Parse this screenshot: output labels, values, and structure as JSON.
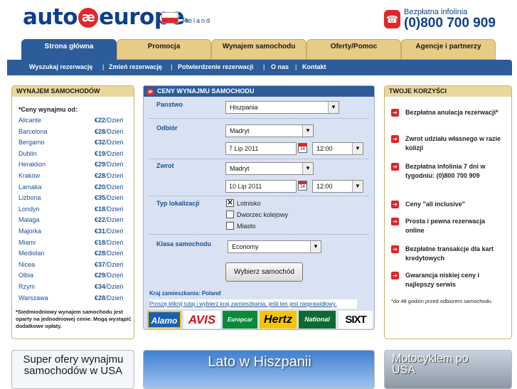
{
  "header": {
    "logo": {
      "left": "auto",
      "mark": "æ",
      "right": "europe",
      "reg": "®"
    },
    "country": "Poland",
    "hotline_label": "Bezpłatna infolinia",
    "hotline_number": "(0)800 700 909"
  },
  "tabs": [
    "Strona główna",
    "Promocja",
    "Wynajem samochodu",
    "Oferty/Pomoc",
    "Agencje i partnerzy"
  ],
  "subnav": [
    "Wyszukaj rezerwację",
    "Zmień rezerwację",
    "Potwierdzenie rezerwacji",
    "O nas",
    "Kontakt"
  ],
  "left": {
    "title": "WYNAJEM SAMOCHODÓW",
    "intro": "*Ceny wynajmu od:",
    "unit": "/Dzień",
    "items": [
      {
        "city": "Alicante",
        "price": "€22"
      },
      {
        "city": "Barcelona",
        "price": "€28"
      },
      {
        "city": "Bergamo",
        "price": "€32"
      },
      {
        "city": "Dublin",
        "price": "€19"
      },
      {
        "city": "Heraklion",
        "price": "€29"
      },
      {
        "city": "Kraków",
        "price": "€28"
      },
      {
        "city": "Larnaka",
        "price": "€20"
      },
      {
        "city": "Lizbona",
        "price": "€35"
      },
      {
        "city": "Londyn",
        "price": "€18"
      },
      {
        "city": "Malaga",
        "price": "€22"
      },
      {
        "city": "Majorka",
        "price": "€31"
      },
      {
        "city": "Miami",
        "price": "€18"
      },
      {
        "city": "Mediolan",
        "price": "€28"
      },
      {
        "city": "Nicea",
        "price": "€37"
      },
      {
        "city": "Olbia",
        "price": "€29"
      },
      {
        "city": "Rzym",
        "price": "€34"
      },
      {
        "city": "Warszawa",
        "price": "€28"
      }
    ],
    "footnote": "*Siedmiodniowy wynajem samochodu jest oparty na jednodniowej cenie. Mogą wystąpić dodatkowe opłaty."
  },
  "form": {
    "title": "CENY WYNAJMU SAMOCHODU",
    "country_label": "Panstwo",
    "country_value": "Hiszpania",
    "pickup_label": "Odbiór",
    "pickup_city": "Madryt",
    "pickup_date": "7 Lip 2011",
    "pickup_time": "12:00",
    "return_label": "Zwrot",
    "return_city": "Madryt",
    "return_date": "10 Lip 2011",
    "return_time": "12:00",
    "location_type_label": "Typ lokalizacji",
    "location_options": [
      {
        "label": "Lotnisko",
        "checked": true
      },
      {
        "label": "Dworzec kolejowy",
        "checked": false
      },
      {
        "label": "Miasto",
        "checked": false
      }
    ],
    "class_label": "Klasa samochodu",
    "class_value": "Economy",
    "submit": "Wybierz samochód",
    "residence": "Kraj zamieszkania: Poland",
    "change_link": "Proszę kliknij tutaj i wybierz kraj zamieszkania, jeśli ten jest nieprawidłowy.",
    "brands": [
      "Alamo",
      "AVIS",
      "Europcar",
      "Hertz",
      "National",
      "SIXT"
    ]
  },
  "benefits": {
    "title": "TWOJE KORZYŚCI",
    "items": [
      "Bezpłatna anulacja rezerwacji*",
      "Zwrot udziału własnego w razie kolizji",
      "Bezpłatna infolinia 7 dni w tygodniu: (0)800 700 909",
      "Ceny \"all inclusive\"",
      "Prosta i pewna rezerwacja online",
      "Bezpłatne transakcje dla kart kredytowych",
      "Gwarancja niskiej ceny i najlepszy serwis"
    ],
    "footnote": "*do 48 godzin przed odbiorem samochodu"
  },
  "banners": {
    "usa": "Super ofery wynajmu samochodów w USA",
    "spain": "Lato w Hiszpanii",
    "moto": "Motocyklem po USA"
  },
  "colors": {
    "brand_blue": "#0e3f8a",
    "nav_blue": "#2c5c9a",
    "accent_red": "#e0262a",
    "tab_gold": "#e6cc86"
  }
}
